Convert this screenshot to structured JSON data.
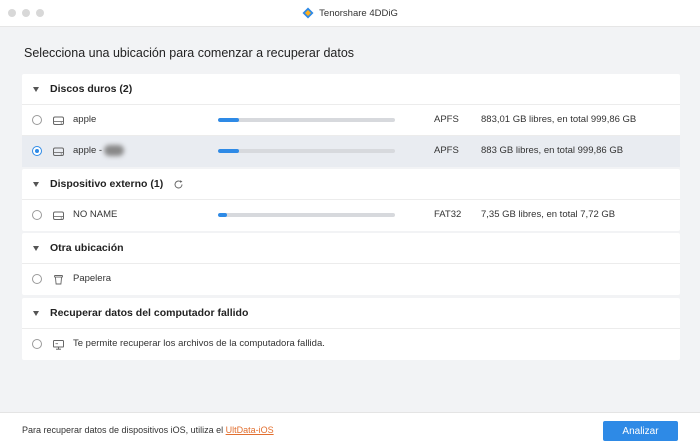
{
  "window": {
    "title": "Tenorshare 4DDiG",
    "logo_icon": "4ddig-logo-icon"
  },
  "main": {
    "heading": "Selecciona una ubicación para comenzar a recuperar datos"
  },
  "sections": {
    "hard_drives": {
      "title": "Discos duros (2)",
      "items": [
        {
          "name": "apple",
          "fill_percent": 12,
          "fs": "APFS",
          "space": "883,01 GB libres, en total 999,86 GB",
          "selected": false,
          "icon": "hard-drive-icon"
        },
        {
          "name": "apple -",
          "fill_percent": 12,
          "fs": "APFS",
          "space": "883 GB libres, en total 999,86 GB",
          "selected": true,
          "icon": "hard-drive-icon"
        }
      ]
    },
    "external": {
      "title": "Dispositivo externo (1)",
      "items": [
        {
          "name": "NO NAME",
          "fill_percent": 5,
          "fs": "FAT32",
          "space": "7,35 GB libres, en total 7,72 GB",
          "selected": false,
          "icon": "usb-drive-icon"
        }
      ]
    },
    "other": {
      "title": "Otra ubicación",
      "items": [
        {
          "name": "Papelera",
          "selected": false,
          "icon": "trash-icon"
        }
      ]
    },
    "crashed": {
      "title": "Recuperar datos del computador fallido",
      "items": [
        {
          "description": "Te permite recuperar los archivos de la computadora fallida.",
          "selected": false,
          "icon": "monitor-icon"
        }
      ]
    }
  },
  "footer": {
    "text": "Para recuperar datos de dispositivos iOS, utiliza el ",
    "link": "UltData-iOS",
    "analyze_button": "Analizar"
  },
  "colors": {
    "accent": "#2e8ae6",
    "link": "#e26f2f",
    "background": "#f2f3f5"
  }
}
